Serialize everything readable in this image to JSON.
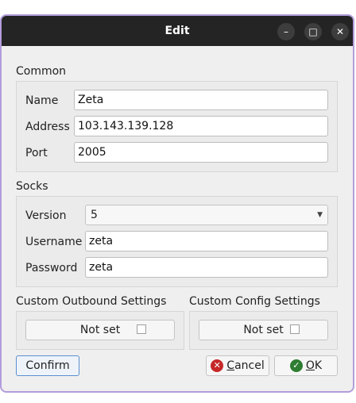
{
  "window": {
    "title": "Edit",
    "minimize_glyph": "–",
    "maximize_glyph": "□",
    "close_glyph": "✕"
  },
  "common": {
    "title": "Common",
    "name_label": "Name",
    "name_value": "Zeta",
    "address_label": "Address",
    "address_value": "103.143.139.128",
    "port_label": "Port",
    "port_value": "2005"
  },
  "socks": {
    "title": "Socks",
    "version_label": "Version",
    "version_value": "5",
    "username_label": "Username",
    "username_value": "zeta",
    "password_label": "Password",
    "password_value": "zeta"
  },
  "outbound": {
    "title": "Custom Outbound Settings",
    "button_label": "Not set"
  },
  "config": {
    "title": "Custom Config Settings",
    "button_label": "Not set"
  },
  "actions": {
    "confirm_label": "Confirm",
    "cancel_first": "C",
    "cancel_rest": "ancel",
    "ok_first": "O",
    "ok_rest": "K"
  },
  "colors": {
    "cancel_icon": "#c62828",
    "ok_icon": "#2e7d32"
  }
}
